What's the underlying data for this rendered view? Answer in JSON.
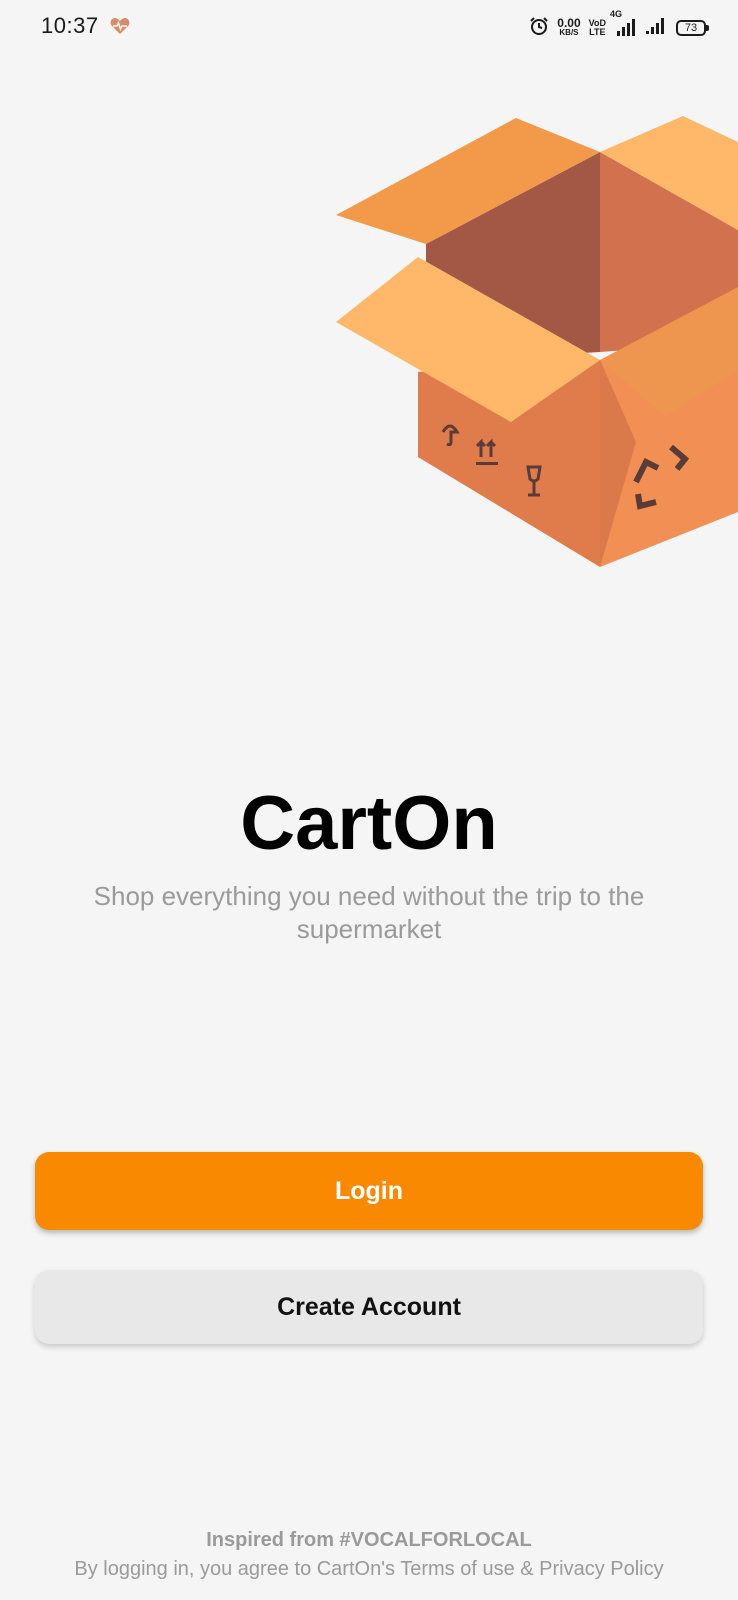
{
  "status_bar": {
    "time": "10:37",
    "net_speed_value": "0.00",
    "net_speed_unit": "KB/S",
    "volte_top": "VoD",
    "volte_bottom": "LTE",
    "network_type": "4G",
    "battery": "73"
  },
  "main": {
    "title": "CartOn",
    "tagline": "Shop everything you need without the trip to the supermarket"
  },
  "buttons": {
    "login_label": "Login",
    "create_account_label": "Create Account"
  },
  "footer": {
    "inspired": "Inspired from #VOCALFORLOCAL",
    "legal": "By logging in, you agree to CartOn's Terms of use & Privacy Policy"
  },
  "colors": {
    "accent": "#f98a00",
    "secondary_button": "#e8e8e8",
    "muted_text": "#9a9a9a",
    "background": "#f5f5f5"
  },
  "icons": [
    "health-heart-icon",
    "alarm-icon",
    "signal-icon",
    "battery-icon",
    "cardboard-box-illustration"
  ]
}
